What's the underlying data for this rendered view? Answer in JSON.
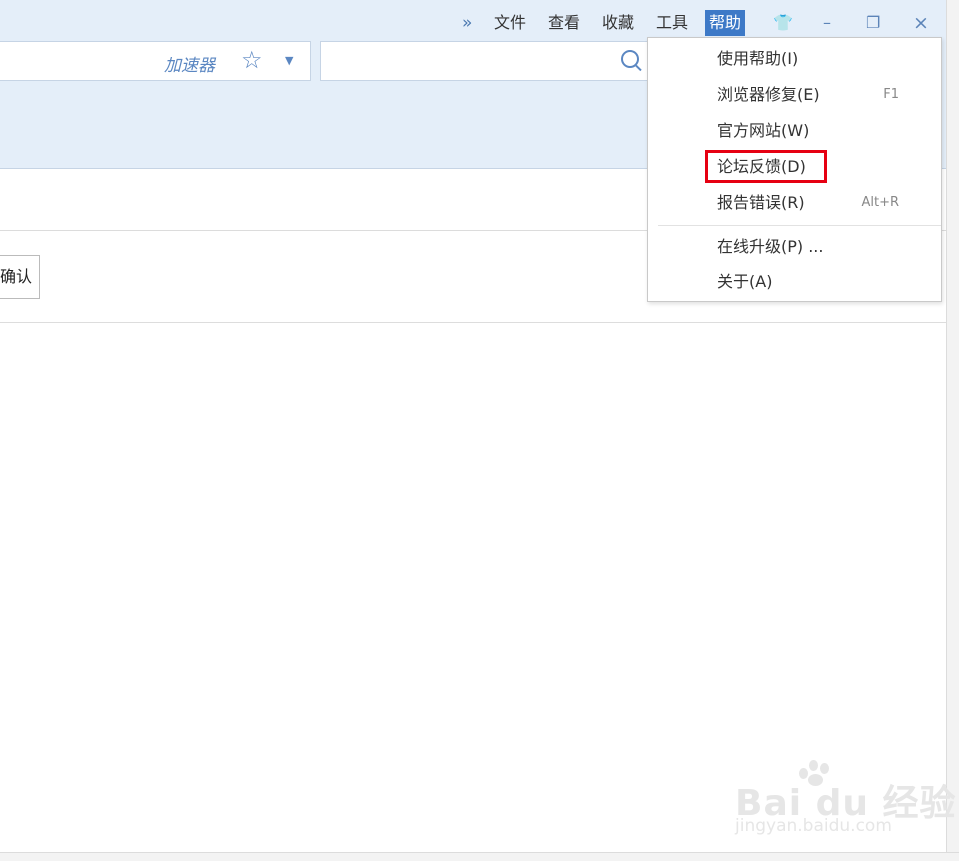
{
  "menu_bar": {
    "overflow": "»",
    "items": [
      "文件",
      "查看",
      "收藏",
      "工具"
    ],
    "active_item": "帮助"
  },
  "window_controls": {
    "skin": "👕",
    "minimize": "–",
    "restore": "❐",
    "close": "×"
  },
  "address_bar": {
    "accelerator_label": "加速器",
    "star": "☆",
    "caret": "▼"
  },
  "search_box": {
    "value": ""
  },
  "page": {
    "confirm_button_partial": "确认"
  },
  "help_menu": {
    "items": [
      {
        "label": "使用帮助(I)",
        "shortcut": ""
      },
      {
        "label": "浏览器修复(E)",
        "shortcut": "F1"
      },
      {
        "label": "官方网站(W)",
        "shortcut": ""
      },
      {
        "label": "论坛反馈(D)",
        "shortcut": ""
      },
      {
        "label": "报告错误(R)",
        "shortcut": "Alt+R"
      },
      {
        "label": "在线升级(P) ...",
        "shortcut": ""
      },
      {
        "label": "关于(A)",
        "shortcut": ""
      }
    ],
    "highlighted_item": "论坛反馈(D)",
    "highlight_color": "#e60012"
  },
  "watermark": {
    "logo_text": "Bai du 经验",
    "url": "jingyan.baidu.com"
  },
  "colors": {
    "chrome_bg": "#e4eef9",
    "menu_active_bg": "#3d79c7",
    "accent_blue": "#5b87c2"
  }
}
